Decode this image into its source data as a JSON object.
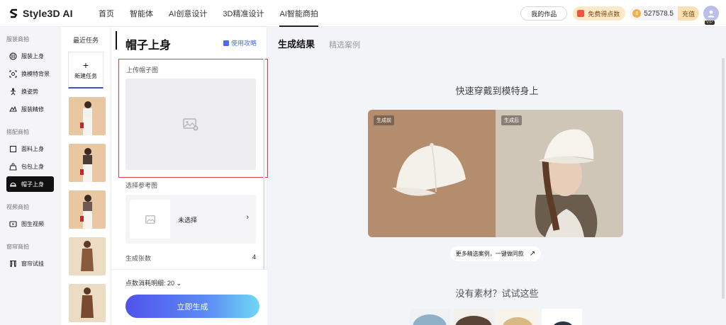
{
  "brand": {
    "name": "Style3D AI"
  },
  "nav": [
    {
      "label": "首页",
      "active": false
    },
    {
      "label": "智能体",
      "active": false
    },
    {
      "label": "AI创意设计",
      "active": false
    },
    {
      "label": "3D精准设计",
      "active": false
    },
    {
      "label": "AI智能商拍",
      "active": true
    }
  ],
  "topright": {
    "my_works": "我的作品",
    "free_points": "免费得点数",
    "coin_icon": "coin-icon",
    "balance": "527578.5",
    "recharge": "充值",
    "vip": "VIP"
  },
  "leftnav": {
    "sections": [
      {
        "title": "服装商拍",
        "items": [
          {
            "label": "服装上身",
            "icon": "tshirt-icon"
          },
          {
            "label": "换模特背景",
            "icon": "scan-face-icon"
          },
          {
            "label": "换姿势",
            "icon": "pose-icon"
          },
          {
            "label": "服装精修",
            "icon": "refine-icon"
          }
        ]
      },
      {
        "title": "搭配商拍",
        "items": [
          {
            "label": "面料上身",
            "icon": "fabric-icon"
          },
          {
            "label": "包包上身",
            "icon": "bag-icon"
          },
          {
            "label": "帽子上身",
            "icon": "hat-icon",
            "active": true
          }
        ]
      },
      {
        "title": "视频商拍",
        "items": [
          {
            "label": "图生视频",
            "icon": "video-icon"
          }
        ]
      },
      {
        "title": "窗帘商拍",
        "items": [
          {
            "label": "窗帘试挂",
            "icon": "curtain-icon"
          }
        ]
      }
    ]
  },
  "recent": {
    "title": "最近任务",
    "new_task": "新建任务",
    "plus": "+"
  },
  "panel": {
    "title": "帽子上身",
    "guide": "使用攻略",
    "upload_label": "上传帽子图",
    "ref_label": "选择参考图",
    "ref_value": "未选择",
    "ref_arrow": "›",
    "count_label": "生成张数",
    "count_value": "4",
    "points_detail": "点数消耗明细: 20",
    "points_caret": "⌄",
    "generate": "立即生成"
  },
  "main": {
    "tab_active": "生成结果",
    "tab_inactive": "精选案例",
    "headline": "快速穿戴到模特身上",
    "tag_before": "生成前",
    "tag_after": "生成后",
    "more_cases": "更多精选案例，一键做同款",
    "more_arrow": "↗",
    "no_material": "没有素材？试试这些"
  }
}
